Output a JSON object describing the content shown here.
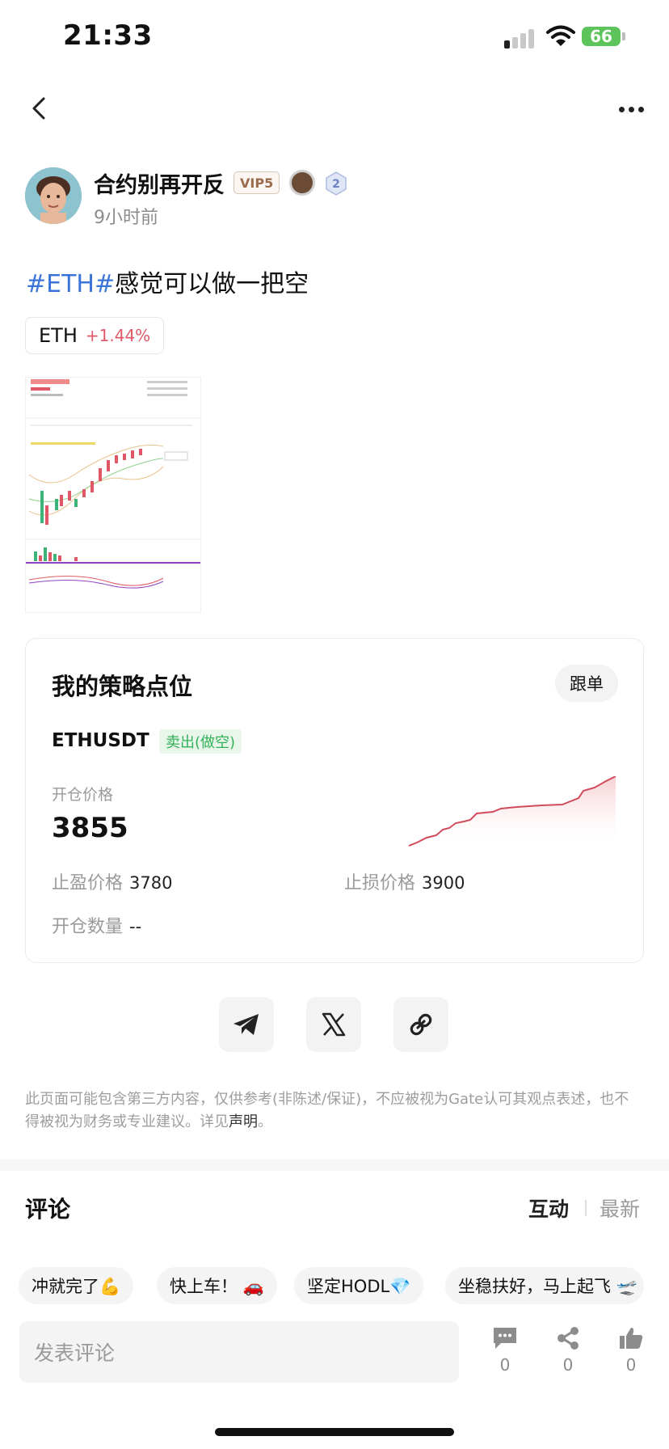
{
  "status": {
    "time": "21:33",
    "battery": "66"
  },
  "author": {
    "name": "合约别再开反",
    "vip": "VIP5",
    "badge_level": "2",
    "time_ago": "9小时前"
  },
  "post": {
    "hashtag": "#ETH#",
    "text": "感觉可以做一把空"
  },
  "coin_tag": {
    "name": "ETH",
    "change": "+1.44%"
  },
  "strategy": {
    "title": "我的策略点位",
    "follow_label": "跟单",
    "pair": "ETHUSDT",
    "side": "卖出(做空)",
    "open_price_label": "开仓价格",
    "open_price": "3855",
    "take_profit_label": "止盈价格",
    "take_profit": "3780",
    "stop_loss_label": "止损价格",
    "stop_loss": "3900",
    "quantity_label": "开仓数量",
    "quantity": "--"
  },
  "share": {
    "icons": [
      "telegram-icon",
      "x-icon",
      "link-icon"
    ]
  },
  "disclaimer": {
    "text": "此页面可能包含第三方内容，仅供参考(非陈述/保证)，不应被视为Gate认可其观点表述，也不得被视为财务或专业建议。详见",
    "link": "声明",
    "end": "。"
  },
  "comments": {
    "title": "评论",
    "tabs": [
      {
        "label": "互动"
      },
      {
        "label": "最新"
      }
    ],
    "chips": [
      {
        "text": "冲就完了💪"
      },
      {
        "text": "快上车！ 🚗"
      },
      {
        "text": "坚定HODL💎"
      },
      {
        "text": "坐稳扶好，马上起飞 🛫"
      }
    ],
    "input_placeholder": "发表评论",
    "actions": [
      {
        "icon": "comment-icon",
        "count": "0"
      },
      {
        "icon": "share-icon",
        "count": "0"
      },
      {
        "icon": "like-icon",
        "count": "0"
      }
    ]
  },
  "colors": {
    "accent_blue": "#3b74d8",
    "up_red": "#e05867",
    "sell_green": "#35b05a"
  }
}
